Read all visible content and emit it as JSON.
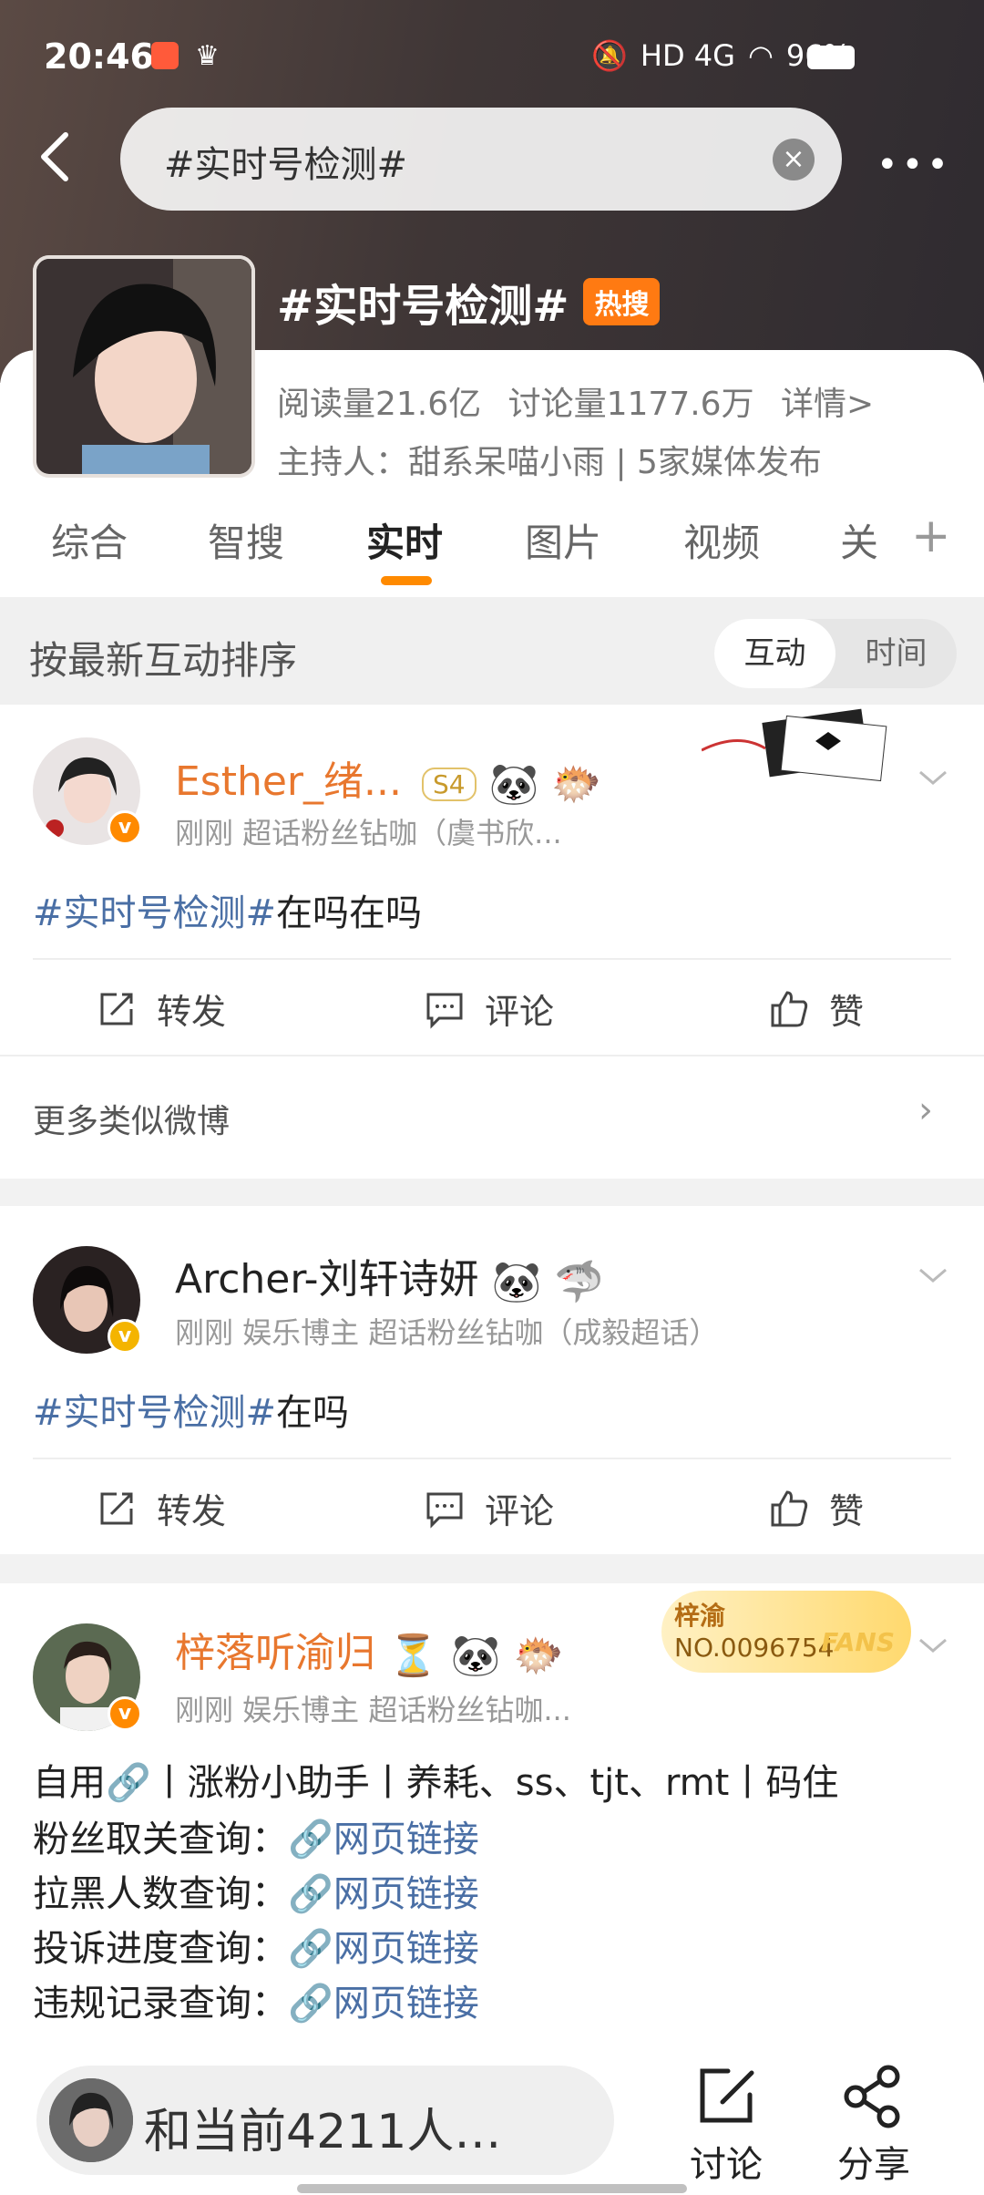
{
  "status_bar": {
    "time": "20:46",
    "right": "HD 4G",
    "battery": "96%"
  },
  "search": {
    "query": "#实时号检测#"
  },
  "topic": {
    "title": "#实时号检测#",
    "hot_badge": "热搜",
    "reads": "阅读量21.6亿",
    "discussions": "讨论量1177.6万",
    "details": "详情>",
    "host": "主持人：甜系呆喵小雨 | 5家媒体发布"
  },
  "tabs": [
    "综合",
    "智搜",
    "实时",
    "图片",
    "视频",
    "关"
  ],
  "sort": {
    "label": "按最新互动排序",
    "option_active": "互动",
    "option_other": "时间"
  },
  "posts": [
    {
      "username": "Esther_绪...",
      "level": "S4",
      "meta": "刚刚   超话粉丝钻咖（虞书欣...",
      "tag": "#实时号检测#",
      "text": "在吗在吗",
      "actions": {
        "repost": "转发",
        "comment": "评论",
        "like": "赞"
      },
      "more_similar": "更多类似微博"
    },
    {
      "username": "Archer-刘轩诗妍",
      "meta": "刚刚   娱乐博主 超话粉丝钻咖（成毅超话）",
      "tag": "#实时号检测#",
      "text": "在吗",
      "actions": {
        "repost": "转发",
        "comment": "评论",
        "like": "赞"
      }
    },
    {
      "username": "梓落听渝归",
      "meta": "刚刚   娱乐博主 超话粉丝钻咖...",
      "fans_card": {
        "name": "梓渝",
        "number": "NO.0096754",
        "label": "FANS"
      },
      "intro": "自用🔗丨涨粉小助手丨养耗、ss、tjt、rmt丨码住",
      "links": [
        {
          "label": "粉丝取关查询：",
          "link": "网页链接"
        },
        {
          "label": "拉黑人数查询：",
          "link": "网页链接"
        },
        {
          "label": "投诉进度查询：",
          "link": "网页链接"
        },
        {
          "label": "违规记录查询：",
          "link": "网页链接"
        }
      ]
    }
  ],
  "bottom_bar": {
    "chat_placeholder": "和当前4211人…",
    "discuss": "讨论",
    "share": "分享"
  }
}
